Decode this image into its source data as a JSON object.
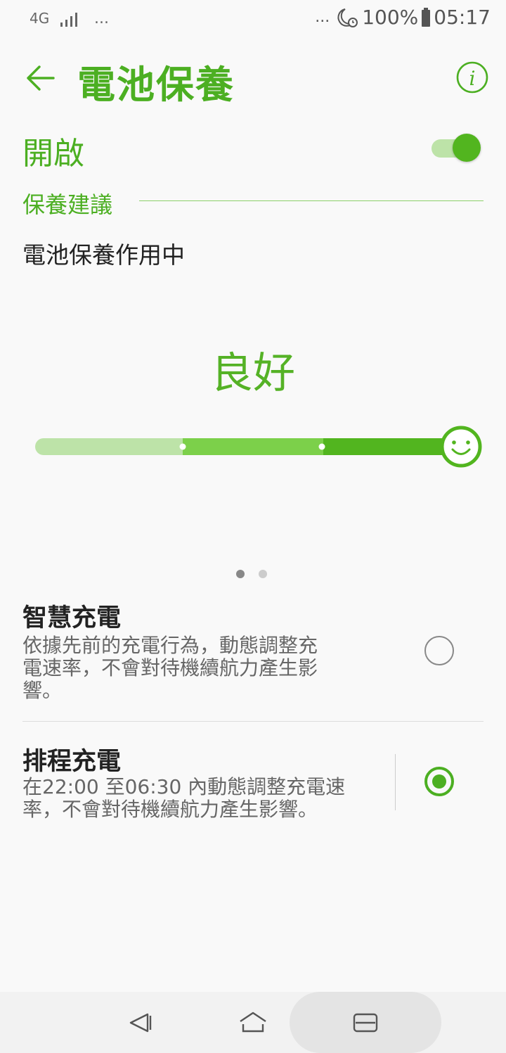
{
  "statusbar": {
    "network": "4G",
    "dots_left": "...",
    "dots_right": "...",
    "battery": "100%",
    "time": "05:17"
  },
  "header": {
    "title": "電池保養"
  },
  "toggle": {
    "label": "開啟",
    "on": true
  },
  "section": {
    "title": "保養建議"
  },
  "status_text": "電池保養作用中",
  "health": {
    "label": "良好"
  },
  "pager": {
    "pages": 2,
    "current": 1
  },
  "options": [
    {
      "title": "智慧充電",
      "desc": "依據先前的充電行為，動態調整充電速率，不會對待機續航力產生影響。",
      "selected": false
    },
    {
      "title": "排程充電",
      "desc": "在22:00 至06:30 內動態調整充電速率，不會對待機續航力產生影響。",
      "selected": true
    }
  ],
  "colors": {
    "accent": "#4caf22",
    "accent_light": "#bde3a8",
    "accent_mid": "#7cd04a"
  }
}
